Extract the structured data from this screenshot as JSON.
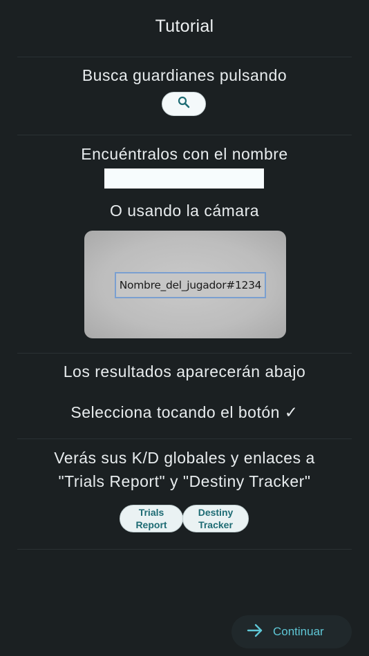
{
  "header": {
    "title": "Tutorial"
  },
  "step_search": {
    "text": "Busca guardianes pulsando",
    "button_icon": "search-icon"
  },
  "step_name": {
    "text": "Encuéntralos con el nombre",
    "input_value": "",
    "input_placeholder": ""
  },
  "step_camera": {
    "text": "O usando la cámara",
    "sample_label": "Nombre_del_jugador#1234"
  },
  "step_results": {
    "text": "Los resultados aparecerán abajo"
  },
  "step_select": {
    "text": "Selecciona tocando el botón ✓"
  },
  "step_links": {
    "line1": "Verás sus K/D globales y enlaces a",
    "line2": "\"Trials Report\" y \"Destiny Tracker\"",
    "buttons": [
      {
        "label": "Trials\nReport"
      },
      {
        "label": "Destiny\nTracker"
      }
    ]
  },
  "footer": {
    "continue_label": "Continuar",
    "continue_icon": "arrow-right-icon"
  },
  "colors": {
    "background": "#1b2022",
    "accent": "#5fc7d6",
    "pill_text": "#1d6b73",
    "camera_frame": "#7a9fd0"
  }
}
